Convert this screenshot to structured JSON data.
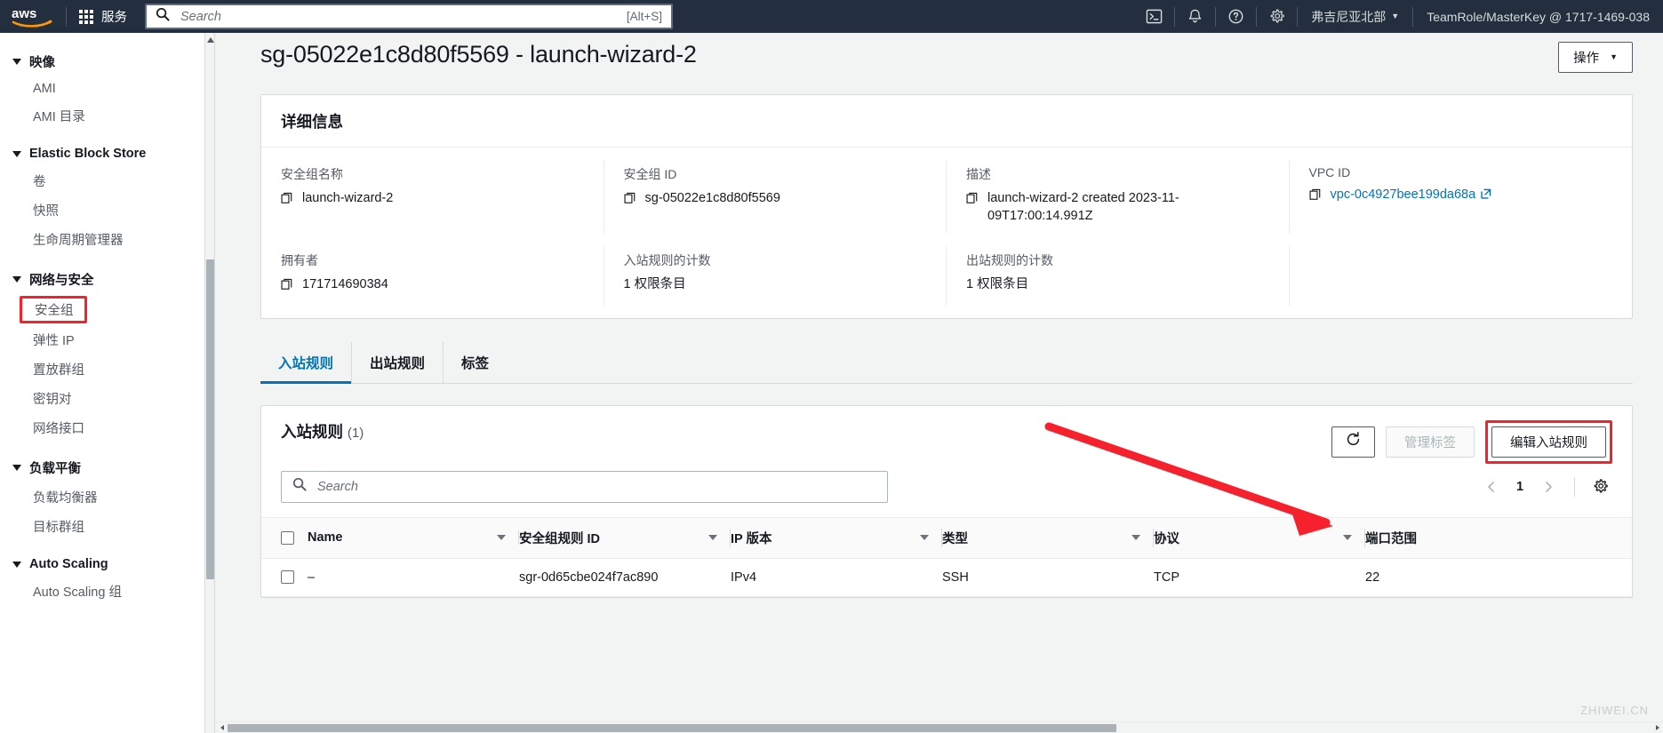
{
  "topnav": {
    "logo_alt": "aws",
    "services_label": "服务",
    "search_placeholder": "Search",
    "search_value": "",
    "search_shortcut": "[Alt+S]",
    "icons": [
      "cloudshell-icon",
      "bell-icon",
      "help-icon",
      "settings-icon"
    ],
    "region_label": "弗吉尼亚北部",
    "account_label": "TeamRole/MasterKey @ 1717-1469-038"
  },
  "sidebar": {
    "sections": [
      {
        "label": "映像",
        "items": [
          {
            "label": "AMI",
            "highlighted": false
          },
          {
            "label": "AMI 目录",
            "highlighted": false
          }
        ]
      },
      {
        "label": "Elastic Block Store",
        "items": [
          {
            "label": "卷",
            "highlighted": false
          },
          {
            "label": "快照",
            "highlighted": false
          },
          {
            "label": "生命周期管理器",
            "highlighted": false
          }
        ]
      },
      {
        "label": "网络与安全",
        "items": [
          {
            "label": "安全组",
            "highlighted": true
          },
          {
            "label": "弹性 IP",
            "highlighted": false
          },
          {
            "label": "置放群组",
            "highlighted": false
          },
          {
            "label": "密钥对",
            "highlighted": false
          },
          {
            "label": "网络接口",
            "highlighted": false
          }
        ]
      },
      {
        "label": "负载平衡",
        "items": [
          {
            "label": "负载均衡器",
            "highlighted": false
          },
          {
            "label": "目标群组",
            "highlighted": false
          }
        ]
      },
      {
        "label": "Auto Scaling",
        "items": [
          {
            "label": "Auto Scaling 组",
            "highlighted": false
          }
        ]
      }
    ]
  },
  "page": {
    "title": "sg-05022e1c8d80f5569 - launch-wizard-2",
    "actions_label": "操作"
  },
  "details": {
    "panel_title": "详细信息",
    "fields": [
      {
        "label": "安全组名称",
        "value": "launch-wizard-2",
        "copyable": true,
        "link": false
      },
      {
        "label": "安全组 ID",
        "value": "sg-05022e1c8d80f5569",
        "copyable": true,
        "link": false
      },
      {
        "label": "描述",
        "value": "launch-wizard-2 created 2023-11-09T17:00:14.991Z",
        "copyable": true,
        "link": false
      },
      {
        "label": "VPC ID",
        "value": "vpc-0c4927bee199da68a",
        "copyable": true,
        "link": true
      },
      {
        "label": "拥有者",
        "value": "171714690384",
        "copyable": true,
        "link": false
      },
      {
        "label": "入站规则的计数",
        "value": "1 权限条目",
        "copyable": false,
        "link": false
      },
      {
        "label": "出站规则的计数",
        "value": "1 权限条目",
        "copyable": false,
        "link": false
      }
    ]
  },
  "tabs": [
    {
      "label": "入站规则",
      "active": true
    },
    {
      "label": "出站规则",
      "active": false
    },
    {
      "label": "标签",
      "active": false
    }
  ],
  "rules": {
    "title": "入站规则",
    "count": "(1)",
    "refresh_label": "refresh-icon",
    "manage_tags_label": "管理标签",
    "manage_tags_disabled": true,
    "edit_label": "编辑入站规则",
    "search_placeholder": "Search",
    "search_value": "",
    "pagination": {
      "prev": "‹",
      "page": "1",
      "next": "›"
    },
    "columns": [
      {
        "label": "Name",
        "sortable": true
      },
      {
        "label": "安全组规则 ID",
        "sortable": true
      },
      {
        "label": "IP 版本",
        "sortable": true
      },
      {
        "label": "类型",
        "sortable": true
      },
      {
        "label": "协议",
        "sortable": true
      },
      {
        "label": "端口范围",
        "sortable": false
      }
    ],
    "rows": [
      {
        "name": "–",
        "rule_id": "sgr-0d65cbe024f7ac890",
        "ip_version": "IPv4",
        "type": "SSH",
        "protocol": "TCP",
        "port_range": "22"
      }
    ]
  },
  "annotations": {
    "highlight_color": "#f5222d",
    "arrow_from": "入站规则表格标题区",
    "arrow_to": "编辑入站规则按钮"
  },
  "watermark": "ZHIWEI.CN"
}
